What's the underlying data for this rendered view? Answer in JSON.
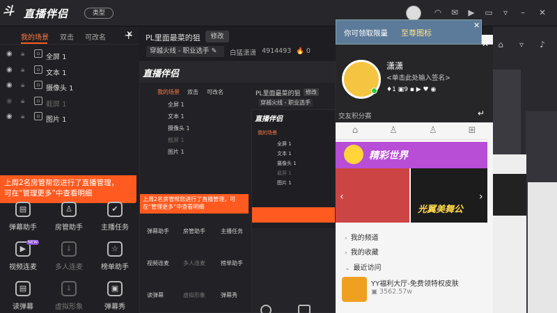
{
  "app": {
    "logo_text": "直播伴侣",
    "logo_mark": "斗",
    "type_pill": "类型"
  },
  "left_panel": {
    "tabs": [
      "我的场景",
      "双击",
      "可改名"
    ],
    "sources": [
      {
        "label": "全屏 1",
        "icon": "fullscreen-icon",
        "visible": true,
        "dim": false
      },
      {
        "label": "文本 1",
        "icon": "text-icon",
        "visible": true,
        "dim": false
      },
      {
        "label": "摄像头 1",
        "icon": "camera-icon",
        "visible": true,
        "dim": false
      },
      {
        "label": "截屏 1",
        "icon": "screenshot-icon",
        "visible": false,
        "dim": true
      },
      {
        "label": "图片 1",
        "icon": "image-icon",
        "visible": true,
        "dim": false
      }
    ],
    "notice": "上周2名房管帮您进行了直播管理，可在“管理更多”中查看明细",
    "tools": [
      {
        "label": "弹幕助手",
        "icon": "danmaku-icon",
        "dim": false
      },
      {
        "label": "房管助手",
        "icon": "admin-icon",
        "dim": false
      },
      {
        "label": "主播任务",
        "icon": "task-icon",
        "dim": false
      },
      {
        "label": "视频连麦",
        "icon": "video-link-icon",
        "dim": false,
        "badge": "NEW"
      },
      {
        "label": "多人连麦",
        "icon": "multi-link-icon",
        "dim": true
      },
      {
        "label": "榜单助手",
        "icon": "rank-icon",
        "dim": false
      },
      {
        "label": "读弹幕",
        "icon": "read-danmaku-icon",
        "dim": false
      },
      {
        "label": "虚拟形象",
        "icon": "avatar-3d-icon",
        "dim": true
      },
      {
        "label": "弹幕秀",
        "icon": "danmaku-show-icon",
        "dim": false
      }
    ]
  },
  "room": {
    "title": "PL里面最菜的狙",
    "edit": "修改",
    "category": "穿越火线 - 职业选手",
    "host": "白猛潇潇",
    "room_id": "4914493",
    "heat": "0"
  },
  "popup": {
    "banner_text": "你可领取限量",
    "banner_gold": "至尊图标",
    "user_name": "潇潇",
    "user_sign": "<单击此处输入签名>",
    "stat_a": "1",
    "stat_b": "9",
    "friend_hint": "交友积分赛",
    "promo_text": "精彩世界",
    "poster_text": "光翼美舞公",
    "menu": [
      "我的频道",
      "我的收藏",
      "最近访问"
    ],
    "recent_title": "YY福利大厅-免费领特权皮肤",
    "recent_count": "3562.57w"
  }
}
